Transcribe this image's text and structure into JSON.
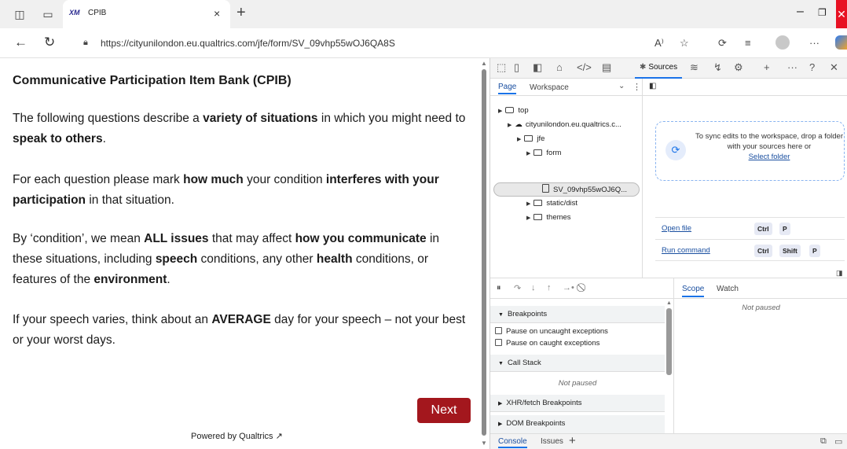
{
  "browser": {
    "tab": {
      "logo": "XM",
      "title": "CPIB",
      "close": "×"
    },
    "new_tab": "+",
    "url": "https://cityunilondon.eu.qualtrics.com/jfe/form/SV_09vhp55wOJ6QA8S",
    "window_controls": {
      "minimize": "–",
      "restore": "❐",
      "close": "✕"
    }
  },
  "survey": {
    "title": "Communicative Participation Item Bank (CPIB)",
    "para1": {
      "t1": "The following questions describe a ",
      "b1": "variety of situations",
      "t2": " in which you might need to ",
      "b2": "speak to others",
      "t3": "."
    },
    "para2": {
      "t1": "For each question please mark ",
      "b1": "how much",
      "t2": " your condition ",
      "b2": "interferes with your participation",
      "t3": " in that situation."
    },
    "para3": {
      "t1": "By ‘condition’, we mean ",
      "b1": "ALL issues",
      "t2": " that may affect ",
      "b2": "how you communicate",
      "t3": " in these situations, including ",
      "b3": "speech",
      "t4": " conditions, any other ",
      "b4": "health",
      "t5": " conditions, or features of the ",
      "b5": "environment",
      "t6": "."
    },
    "para4": {
      "t1": "If your speech varies, think about an ",
      "b1": "AVERAGE",
      "t2": " day for your speech – not your best or your worst days."
    },
    "next_label": "Next",
    "powered_by": "Powered by Qualtrics"
  },
  "devtools": {
    "active_tab": "Sources",
    "navigator": {
      "tabs": [
        "Page",
        "Workspace"
      ],
      "tree": [
        "top",
        "cityunilondon.eu.qualtrics.c...",
        "jfe",
        "form",
        "SV_09vhp55wOJ6Q...",
        "static/dist",
        "themes"
      ]
    },
    "editor": {
      "drop_text": "To sync edits to the workspace, drop a folder with your sources here or",
      "select_folder": "Select folder",
      "open_file": "Open file",
      "open_file_keys": [
        "Ctrl",
        "P"
      ],
      "run_command": "Run command",
      "run_command_keys": [
        "Ctrl",
        "Shift",
        "P"
      ]
    },
    "debugger": {
      "breakpoints": "Breakpoints",
      "pause_uncaught": "Pause on uncaught exceptions",
      "pause_caught": "Pause on caught exceptions",
      "call_stack": "Call Stack",
      "call_stack_status": "Not paused",
      "xhr": "XHR/fetch Breakpoints",
      "dom": "DOM Breakpoints",
      "scope_tab": "Scope",
      "watch_tab": "Watch",
      "scope_status": "Not paused"
    },
    "drawer": {
      "console": "Console",
      "issues": "Issues",
      "add": "+"
    }
  }
}
